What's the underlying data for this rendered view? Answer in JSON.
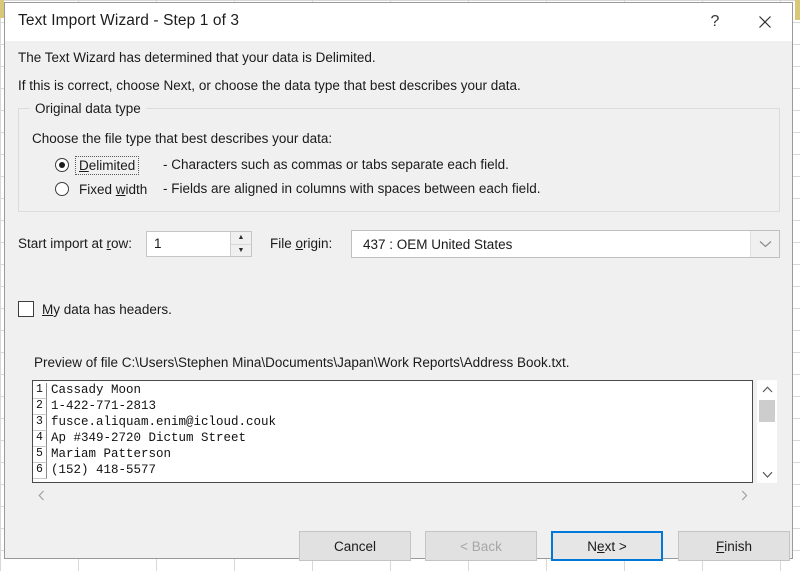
{
  "window": {
    "title": "Text Import Wizard - Step 1 of 3",
    "help_icon": "question-mark-icon",
    "close_icon": "close-icon"
  },
  "intro": {
    "line1": "The Text Wizard has determined that your data is Delimited.",
    "line2": "If this is correct, choose Next, or choose the data type that best describes your data."
  },
  "group": {
    "legend": "Original data type",
    "description": "Choose the file type that best describes your data:",
    "options": [
      {
        "label": "Delimited",
        "accel": "D",
        "description": "- Characters such as commas or tabs separate each field.",
        "selected": true,
        "focused": true
      },
      {
        "label": "Fixed width",
        "accel": "w",
        "description": "- Fields are aligned in columns with spaces between each field.",
        "selected": false,
        "focused": false
      }
    ]
  },
  "start_row": {
    "label": "Start import at row:",
    "accel": "r",
    "value": "1",
    "up_icon": "spinner-up-icon",
    "down_icon": "spinner-down-icon"
  },
  "file_origin": {
    "label": "File origin:",
    "accel": "o",
    "value": "437 : OEM United States",
    "arrow_icon": "chevron-down-icon"
  },
  "headers": {
    "label": "My data has headers.",
    "accel": "M",
    "checked": false
  },
  "preview": {
    "caption": "Preview of file C:\\Users\\Stephen Mina\\Documents\\Japan\\Work Reports\\Address Book.txt.",
    "lines": [
      {
        "num": "1",
        "text": "Cassady Moon"
      },
      {
        "num": "2",
        "text": "1-422-771-2813"
      },
      {
        "num": "3",
        "text": "fusce.aliquam.enim@icloud.couk"
      },
      {
        "num": "4",
        "text": "Ap #349-2720 Dictum Street"
      },
      {
        "num": "5",
        "text": "Mariam Patterson"
      },
      {
        "num": "6",
        "text": "(152) 418-5577"
      }
    ],
    "vscroll": {
      "up_icon": "scroll-up-icon",
      "down_icon": "scroll-down-icon"
    },
    "hscroll": {
      "left_icon": "scroll-left-icon",
      "right_icon": "scroll-right-icon"
    }
  },
  "buttons": {
    "cancel": "Cancel",
    "back": "< Back",
    "next_pre": "N",
    "next_accel": "e",
    "next_post": "xt >",
    "finish_accel": "F",
    "finish_post": "inish"
  },
  "colors": {
    "focus_blue": "#0078d7",
    "dialog_bg": "#f0f0f0",
    "text": "#1a1a1a",
    "disabled_text": "#a6a6a6"
  }
}
